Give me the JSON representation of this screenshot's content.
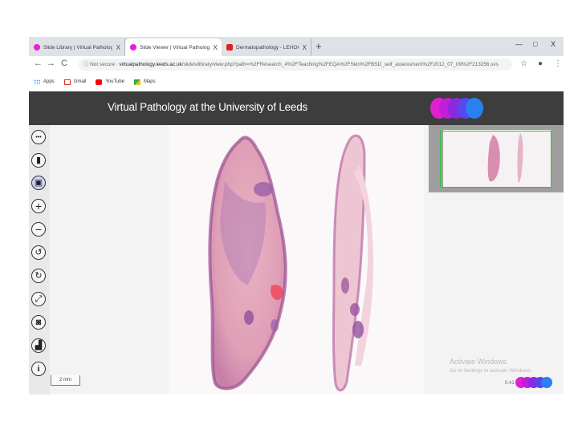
{
  "tabs": [
    {
      "label": "Slide Library | Virtual Pathology",
      "color": "#e91ed9",
      "close": "X"
    },
    {
      "label": "Slide Viewer | Virtual Pathology",
      "color": "#e91ed9",
      "close": "X"
    },
    {
      "label": "Dermatopathology - LEHOGY",
      "color": "#e02020",
      "close": "X"
    }
  ],
  "new_tab": "+",
  "window_controls": {
    "minimize": "—",
    "maximize": "□",
    "close": "X"
  },
  "nav": {
    "back": "←",
    "forward": "→",
    "reload": "C"
  },
  "address": {
    "security": "ⓘ Not secure",
    "host": "virtualpathology.leeds.ac.uk",
    "path": "/slides/library/view.php?path=%2FResearch_4%2FTeaching%2FEQA%2FSkin%2FBSD_self_assessment%2F2012_07_09%2F213256.svs"
  },
  "bookmarks": [
    {
      "label": "Apps",
      "icon": "apps-grid-icon",
      "color": "#4285f4"
    },
    {
      "label": "Gmail",
      "icon": "gmail-icon",
      "color": "#d93025"
    },
    {
      "label": "YouTube",
      "icon": "youtube-icon",
      "color": "#ff0000"
    },
    {
      "label": "Maps",
      "icon": "maps-icon",
      "color": "#34a853"
    }
  ],
  "header": {
    "title": "Virtual Pathology at the University of Leeds"
  },
  "logo_colors": [
    "#e020d0",
    "#c01ed8",
    "#8a2ae0",
    "#5a46ee",
    "#2a80f0"
  ],
  "tools": [
    {
      "name": "menu",
      "glyph": "•••"
    },
    {
      "name": "annotation",
      "glyph": "▮"
    },
    {
      "name": "image",
      "glyph": "▣"
    },
    {
      "name": "zoom-in",
      "glyph": "+"
    },
    {
      "name": "zoom-out",
      "glyph": "−"
    },
    {
      "name": "rotate-left",
      "glyph": "↺"
    },
    {
      "name": "rotate-right",
      "glyph": "↻"
    },
    {
      "name": "fullscreen",
      "glyph": "⤢"
    },
    {
      "name": "camera",
      "glyph": "◙"
    },
    {
      "name": "stats",
      "glyph": "▟"
    },
    {
      "name": "info",
      "glyph": "i"
    }
  ],
  "scale_bar": "2 mm",
  "watermark": {
    "title": "Activate Windows",
    "subtitle": "Go to Settings to activate Windows."
  },
  "zoom_level": "0.41"
}
